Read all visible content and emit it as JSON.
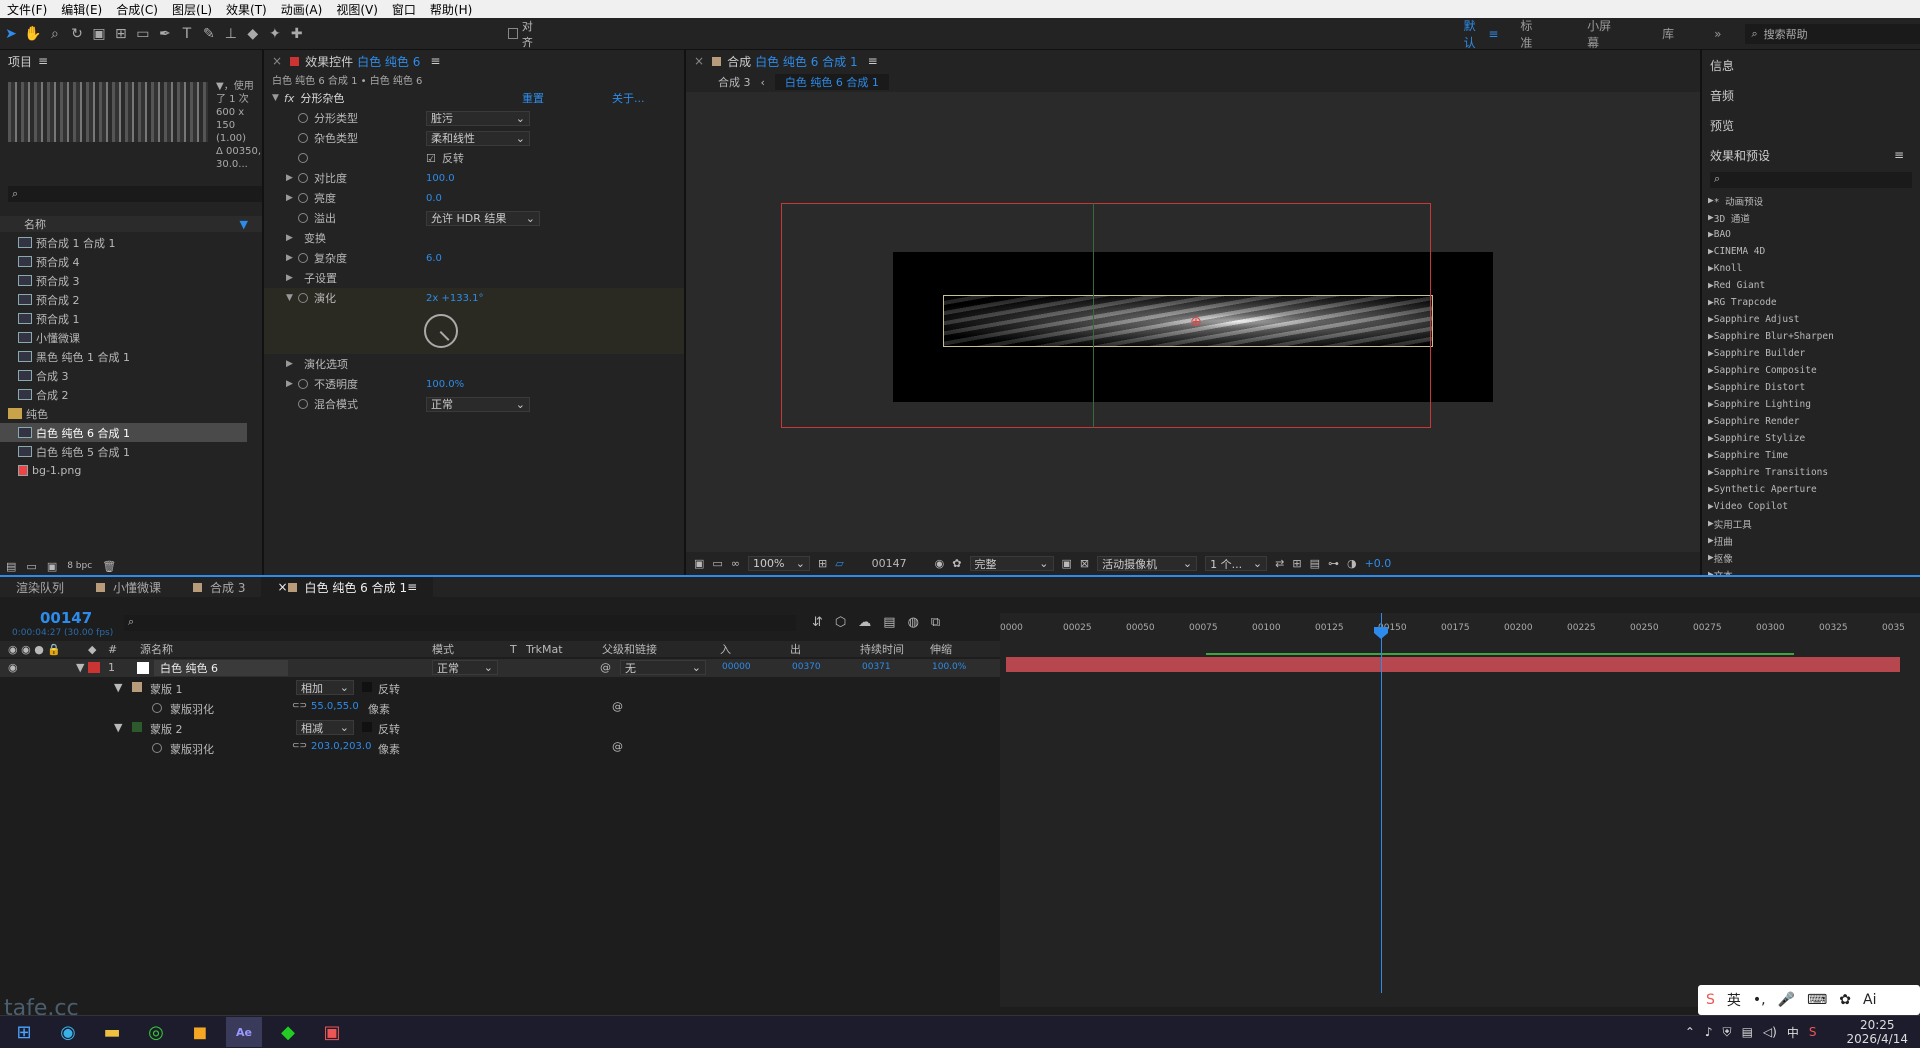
{
  "menu": [
    "文件(F)",
    "编辑(E)",
    "合成(C)",
    "图层(L)",
    "效果(T)",
    "动画(A)",
    "视图(V)",
    "窗口",
    "帮助(H)"
  ],
  "toolbar": {
    "align_label": "对齐",
    "workspaces": [
      "默认",
      "标准",
      "小屏幕",
      "库"
    ],
    "active_ws": "默认",
    "search_placeholder": "搜索帮助"
  },
  "project": {
    "title": "项目",
    "used": "▼，使用了 1 次",
    "dims": "600 x 150 (1.00)",
    "dur": "Δ 00350, 30.0...",
    "col_name": "名称",
    "items": [
      "预合成 1 合成 1",
      "预合成 4",
      "预合成 3",
      "预合成 2",
      "预合成 1",
      "小懂微课",
      "黑色 纯色 1 合成 1",
      "合成 3",
      "合成 2",
      "纯色",
      "白色 纯色 6 合成 1",
      "白色 纯色 5 合成 1",
      "bg-1.png"
    ],
    "selected": "白色 纯色 6 合成 1",
    "bpc": "8 bpc"
  },
  "effect": {
    "tab": "效果控件",
    "layer": "白色 纯色 6",
    "path": "白色 纯色 6 合成 1 • 白色 纯色 6",
    "fx_name": "分形杂色",
    "reset": "重置",
    "about": "关于...",
    "props": [
      {
        "name": "分形类型",
        "value": "脏污",
        "dd": true
      },
      {
        "name": "杂色类型",
        "value": "柔和线性",
        "dd": true
      },
      {
        "name": "",
        "value": "反转",
        "cb": true
      },
      {
        "name": "对比度",
        "value": "100.0",
        "tw": true
      },
      {
        "name": "亮度",
        "value": "0.0",
        "tw": true
      },
      {
        "name": "溢出",
        "value": "允许 HDR 结果",
        "dd": true
      },
      {
        "name": "变换",
        "value": "",
        "group": true
      },
      {
        "name": "复杂度",
        "value": "6.0",
        "tw": true
      },
      {
        "name": "子设置",
        "value": "",
        "group": true
      },
      {
        "name": "演化",
        "value": "2x +133.1°",
        "tw": true,
        "open": true
      },
      {
        "name": "演化选项",
        "value": "",
        "group": true
      },
      {
        "name": "不透明度",
        "value": "100.0%",
        "tw": true
      },
      {
        "name": "混合模式",
        "value": "正常",
        "dd": true
      }
    ]
  },
  "comp": {
    "tab": "合成",
    "name": "白色 纯色 6 合成 1",
    "crumb1": "合成 3",
    "crumb2": "白色 纯色 6 合成 1",
    "zoom": "100%",
    "frame": "00147",
    "quality": "完整",
    "camera": "活动摄像机",
    "views": "1 个...",
    "exposure": "+0.0"
  },
  "right": {
    "info": "信息",
    "audio": "音频",
    "preview": "预览",
    "effects": "效果和预设",
    "search_placeholder": "",
    "list": [
      "* 动画预设",
      "3D 通道",
      "BAO",
      "CINEMA 4D",
      "Knoll",
      "Red Giant",
      "RG Trapcode",
      "Sapphire Adjust",
      "Sapphire Blur+Sharpen",
      "Sapphire Builder",
      "Sapphire Composite",
      "Sapphire Distort",
      "Sapphire Lighting",
      "Sapphire Render",
      "Sapphire Stylize",
      "Sapphire Time",
      "Sapphire Transitions",
      "Synthetic Aperture",
      "Video Copilot",
      "实用工具",
      "扭曲",
      "抠像",
      "文本"
    ]
  },
  "timeline": {
    "tabs": [
      "渲染队列",
      "小懂微课",
      "合成 3",
      "白色 纯色 6 合成 1"
    ],
    "active_tab": "白色 纯色 6 合成 1",
    "timecode": "00147",
    "timecode_sub": "0:00:04:27 (30.00 fps)",
    "cols": {
      "source": "源名称",
      "mode": "模式",
      "t": "T",
      "trkmat": "TrkMat",
      "parent": "父级和链接",
      "in": "入",
      "out": "出",
      "dur": "持续时间",
      "stretch": "伸缩"
    },
    "layer": {
      "num": "1",
      "name": "白色 纯色 6",
      "mode": "正常",
      "parent": "无",
      "in": "00000",
      "out": "00370",
      "dur": "00371",
      "stretch": "100.0%"
    },
    "masks": [
      {
        "name": "蒙版 1",
        "mode": "相加",
        "invert": "反转",
        "feather_label": "蒙版羽化",
        "feather": "55.0,55.0",
        "unit": "像素"
      },
      {
        "name": "蒙版 2",
        "mode": "相减",
        "invert": "反转",
        "feather_label": "蒙版羽化",
        "feather": "203.0,203.0",
        "unit": "像素"
      }
    ],
    "ruler": [
      "0000",
      "00025",
      "00050",
      "00075",
      "00100",
      "00125",
      "00150",
      "00175",
      "00200",
      "00225",
      "00250",
      "00275",
      "00300",
      "00325",
      "0035"
    ]
  },
  "taskbar": {
    "time": "20:25",
    "date": "2026/4/14",
    "ime": "英",
    "ai": "Ai"
  },
  "watermark": "tafe.cc"
}
